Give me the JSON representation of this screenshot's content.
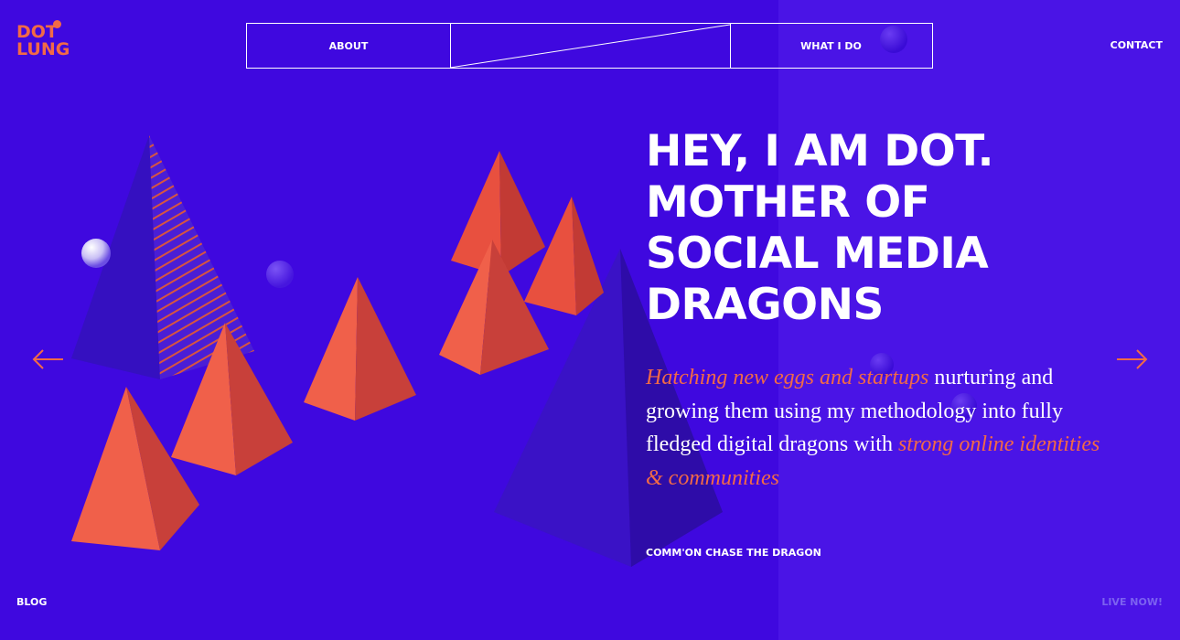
{
  "logo": {
    "line1": "DOT",
    "line2": "LUNG"
  },
  "nav": {
    "about": "ABOUT",
    "what_i_do": "WHAT I DO",
    "contact": "CONTACT",
    "blog": "BLOG",
    "live_now": "LIVE NOW!"
  },
  "hero": {
    "title_lines": [
      "HEY, I AM DOT.",
      "MOTHER OF",
      "SOCIAL MEDIA",
      "DRAGONS"
    ],
    "desc_em1": "Hatching new eggs and startups",
    "desc_plain1": " nurturing and growing them using my methodology into fully fledged digital dragons with ",
    "desc_em2": "strong online identities & communities",
    "cta": "COMM'ON CHASE THE DRAGON"
  },
  "icons": {
    "prev": "arrow-left-icon",
    "next": "arrow-right-icon"
  },
  "colors": {
    "background": "#3f08df",
    "panel": "#4a14e6",
    "accent": "#f26a46",
    "text": "#ffffff"
  }
}
